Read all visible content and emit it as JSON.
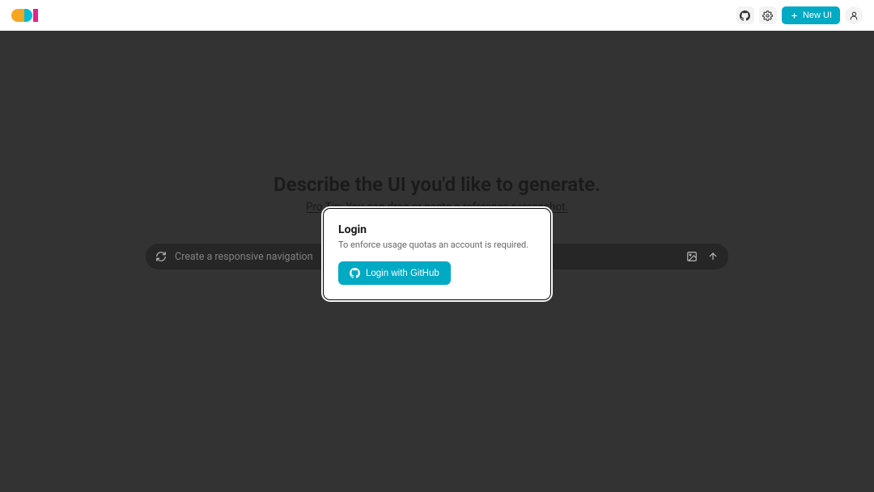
{
  "header": {
    "new_ui_label": "New UI"
  },
  "main": {
    "title": "Describe the UI you'd like to generate.",
    "subtitle": "Pro Tip: You can drag or paste a reference screenshot.",
    "input_placeholder": "Create a responsive navigation"
  },
  "modal": {
    "title": "Login",
    "description": "To enforce usage quotas an account is required.",
    "login_button": "Login with GitHub"
  },
  "colors": {
    "accent": "#00a9c4",
    "bg_dark": "#333333",
    "bg_header": "#ffffff"
  }
}
